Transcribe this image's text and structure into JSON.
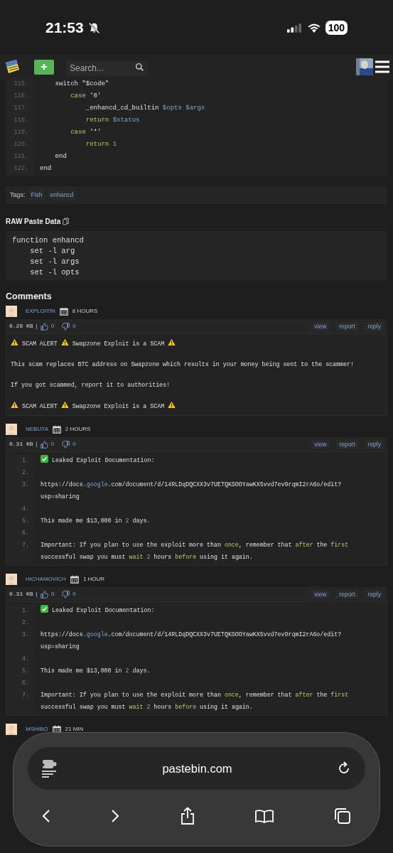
{
  "status_bar": {
    "time": "21:53",
    "battery": "100"
  },
  "header": {
    "search": {
      "placeholder": "Search..."
    }
  },
  "code": {
    "lines": [
      {
        "number": "115.",
        "tokens": [
          {
            "text": "    switch \"$code\"",
            "kind": "plain"
          }
        ]
      },
      {
        "number": "116.",
        "tokens": [
          {
            "text": "        case",
            "kind": "keyword"
          },
          {
            "text": " '0'",
            "kind": "plain"
          }
        ]
      },
      {
        "number": "117.",
        "tokens": [
          {
            "text": "            _enhancd_cd_builtin ",
            "kind": "plain"
          },
          {
            "text": "$opts $args",
            "kind": "variable"
          }
        ]
      },
      {
        "number": "118.",
        "tokens": [
          {
            "text": "            return ",
            "kind": "keyword"
          },
          {
            "text": "$status",
            "kind": "variable"
          }
        ]
      },
      {
        "number": "119.",
        "tokens": [
          {
            "text": "        case",
            "kind": "keyword"
          },
          {
            "text": " '*'",
            "kind": "plain"
          }
        ]
      },
      {
        "number": "120.",
        "tokens": [
          {
            "text": "            return ",
            "kind": "keyword"
          },
          {
            "text": "1",
            "kind": "number"
          }
        ]
      },
      {
        "number": "121.",
        "tokens": [
          {
            "text": "    end",
            "kind": "plain"
          }
        ]
      },
      {
        "number": "122.",
        "tokens": [
          {
            "text": "end",
            "kind": "plain"
          }
        ]
      }
    ]
  },
  "tags": {
    "label": "Tags:",
    "items": [
      "Fish",
      "enhancd"
    ]
  },
  "raw": {
    "title": "RAW Paste Data",
    "lines": [
      "function enhancd",
      "    set -l arg",
      "    set -l args",
      "    set -l opts"
    ]
  },
  "comments_title": "Comments",
  "comments": [
    {
      "author": "EXPLOITIN",
      "time": "8 HOURS",
      "size": "0.26 KB",
      "separator": "|",
      "likes": "0",
      "dislikes": "0",
      "actions": [
        "view",
        "report",
        "reply"
      ],
      "body": {
        "kind": "plain",
        "lines": [
          {
            "tokens": [
              {
                "kind": "warning"
              },
              {
                "text": " SCAM ALERT ",
                "kind": "plain"
              },
              {
                "kind": "warning"
              },
              {
                "text": " Swapzone Exploit is a SCAM ",
                "kind": "plain"
              },
              {
                "kind": "warning"
              }
            ]
          },
          {
            "tokens": [
              {
                "text": "This scam replaces BTC address on Swapzone which results in your money being sent to the scammer!",
                "kind": "plain"
              }
            ]
          },
          {
            "tokens": [
              {
                "text": "If you got scammed, report it to authorities!",
                "kind": "plain"
              }
            ]
          },
          {
            "tokens": [
              {
                "kind": "warning"
              },
              {
                "text": " SCAM ALERT ",
                "kind": "plain"
              },
              {
                "kind": "warning"
              },
              {
                "text": " Swapzone Exploit is a SCAM ",
                "kind": "plain"
              },
              {
                "kind": "warning"
              }
            ]
          }
        ]
      }
    },
    {
      "author": "NEBUTA",
      "time": "2 HOURS",
      "size": "0.31 KB",
      "separator": "|",
      "likes": "0",
      "dislikes": "0",
      "actions": [
        "view",
        "report",
        "reply"
      ],
      "body": {
        "kind": "numbered",
        "lines": [
          {
            "number": "1.",
            "tokens": [
              {
                "kind": "check"
              },
              {
                "text": " Leaked Exploit Documentation:",
                "kind": "plain"
              }
            ]
          },
          {
            "number": "2."
          },
          {
            "number": "3.",
            "tokens": [
              {
                "text": "https://docs.",
                "kind": "plain"
              },
              {
                "text": "google",
                "kind": "variable"
              },
              {
                "text": ".com/document/d/14RLDqDQCXX3v7UETQKSOOYawKX5vvd7ev9rqmI2rA6o/edit? usp=sharing",
                "kind": "plain"
              }
            ]
          },
          {
            "number": "4."
          },
          {
            "number": "5.",
            "tokens": [
              {
                "text": "This made me $13,000 in ",
                "kind": "plain"
              },
              {
                "text": "2",
                "kind": "number"
              },
              {
                "text": " days.",
                "kind": "plain"
              }
            ]
          },
          {
            "number": "6."
          },
          {
            "number": "7.",
            "tokens": [
              {
                "text": "Important: If you plan to use the exploit more than ",
                "kind": "plain"
              },
              {
                "text": "once",
                "kind": "keyword"
              },
              {
                "text": ", remember that ",
                "kind": "plain"
              },
              {
                "text": "after",
                "kind": "keyword"
              },
              {
                "text": " the ",
                "kind": "plain"
              },
              {
                "text": "first",
                "kind": "keyword"
              },
              {
                "text": " successful swap you must ",
                "kind": "plain"
              },
              {
                "text": "wait",
                "kind": "keyword"
              },
              {
                "text": " 2",
                "kind": "number"
              },
              {
                "text": " hours ",
                "kind": "plain"
              },
              {
                "text": "before",
                "kind": "keyword"
              },
              {
                "text": " using it again.",
                "kind": "plain"
              }
            ]
          }
        ]
      }
    },
    {
      "author": "HICHAMOVICH",
      "time": "1 HOUR",
      "size": "0.31 KB",
      "separator": "|",
      "likes": "0",
      "dislikes": "0",
      "actions": [
        "view",
        "report",
        "reply"
      ],
      "body": {
        "kind": "numbered",
        "lines": [
          {
            "number": "1.",
            "tokens": [
              {
                "kind": "check"
              },
              {
                "text": " Leaked Exploit Documentation:",
                "kind": "plain"
              }
            ]
          },
          {
            "number": "2."
          },
          {
            "number": "3.",
            "tokens": [
              {
                "text": "https://docs.",
                "kind": "plain"
              },
              {
                "text": "google",
                "kind": "variable"
              },
              {
                "text": ".com/document/d/14RLDqDQCXX3v7UETQKSOOYawKX5vvd7ev9rqmI2rA6o/edit? usp=sharing",
                "kind": "plain"
              }
            ]
          },
          {
            "number": "4."
          },
          {
            "number": "5.",
            "tokens": [
              {
                "text": "This made me $13,000 in ",
                "kind": "plain"
              },
              {
                "text": "2",
                "kind": "number"
              },
              {
                "text": " days.",
                "kind": "plain"
              }
            ]
          },
          {
            "number": "6."
          },
          {
            "number": "7.",
            "tokens": [
              {
                "text": "Important: If you plan to use the exploit more than ",
                "kind": "plain"
              },
              {
                "text": "once",
                "kind": "keyword"
              },
              {
                "text": ", remember that ",
                "kind": "plain"
              },
              {
                "text": "after",
                "kind": "keyword"
              },
              {
                "text": " the ",
                "kind": "plain"
              },
              {
                "text": "first",
                "kind": "keyword"
              },
              {
                "text": " successful swap you must ",
                "kind": "plain"
              },
              {
                "text": "wait",
                "kind": "keyword"
              },
              {
                "text": " 2",
                "kind": "number"
              },
              {
                "text": " hours ",
                "kind": "plain"
              },
              {
                "text": "before",
                "kind": "keyword"
              },
              {
                "text": " using it again.",
                "kind": "plain"
              }
            ]
          }
        ]
      }
    },
    {
      "author": "MSHIBO",
      "time": "21 MIN"
    }
  ],
  "browser": {
    "url": "pastebin.com"
  }
}
